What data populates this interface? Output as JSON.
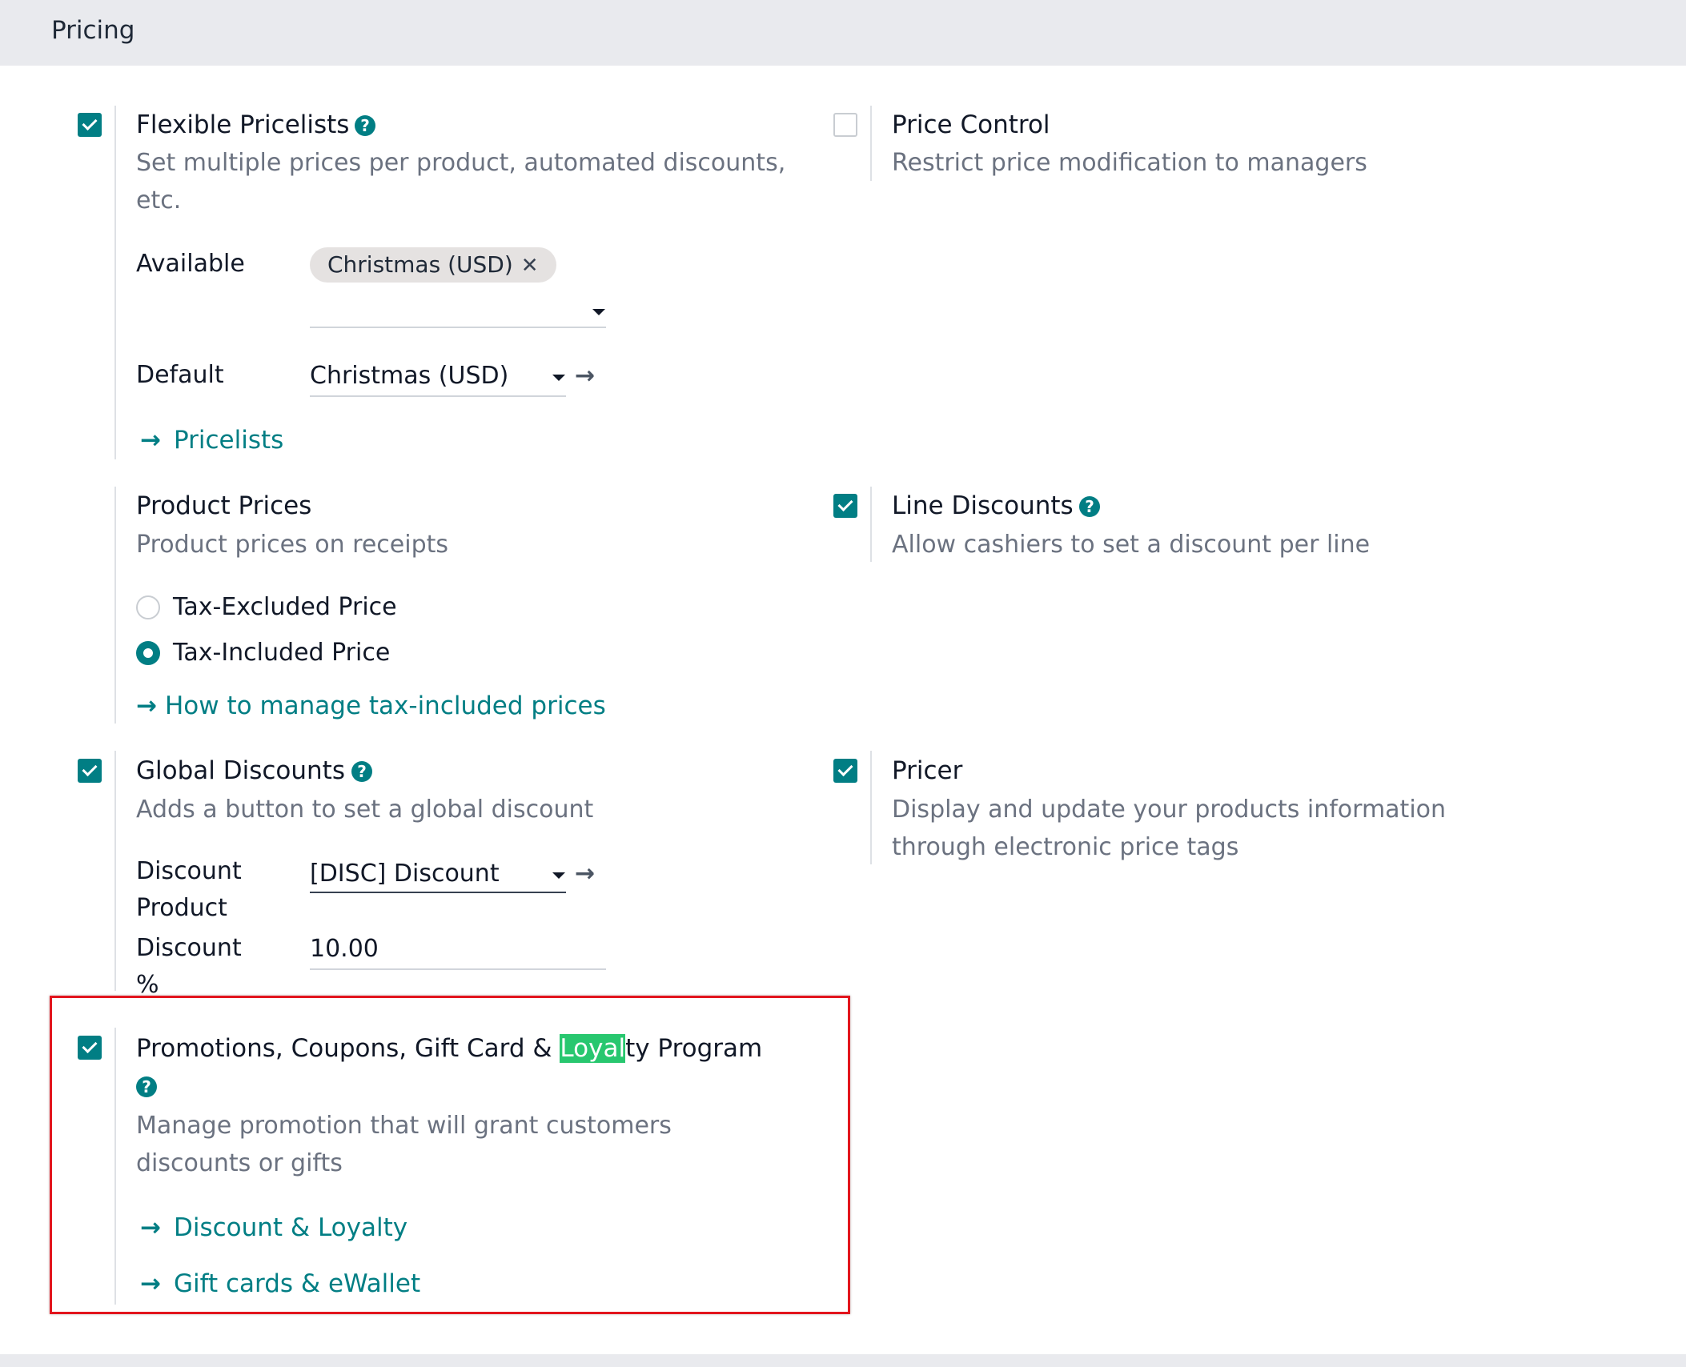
{
  "header": {
    "title": "Pricing"
  },
  "flexible_pricelists": {
    "title": "Flexible Pricelists",
    "checked": true,
    "description": "Set multiple prices per product, automated discounts, etc.",
    "available_label": "Available",
    "available_tags": [
      "Christmas (USD)"
    ],
    "default_label": "Default",
    "default_value": "Christmas (USD)",
    "link": "Pricelists"
  },
  "price_control": {
    "title": "Price Control",
    "checked": false,
    "description": "Restrict price modification to managers"
  },
  "product_prices": {
    "title": "Product Prices",
    "description": "Product prices on receipts",
    "options": [
      {
        "label": "Tax-Excluded Price",
        "selected": false
      },
      {
        "label": "Tax-Included Price",
        "selected": true
      }
    ],
    "link": "How to manage tax-included prices"
  },
  "line_discounts": {
    "title": "Line Discounts",
    "checked": true,
    "description": "Allow cashiers to set a discount per line"
  },
  "global_discounts": {
    "title": "Global Discounts",
    "checked": true,
    "description": "Adds a button to set a global discount",
    "discount_product_label": "Discount Product",
    "discount_product_value": "[DISC] Discount",
    "discount_pct_label": "Discount %",
    "discount_pct_value": "10.00"
  },
  "pricer": {
    "title": "Pricer",
    "checked": true,
    "description": "Display and update your products information through electronic price tags"
  },
  "promotions": {
    "title_before": "Promotions, Coupons, Gift Card & ",
    "title_highlight": "Loyal",
    "title_after": "ty Program",
    "checked": true,
    "description": "Manage promotion that will grant customers discounts or gifts",
    "links": [
      "Discount & Loyalty",
      "Gift cards & eWallet"
    ]
  },
  "icons": {
    "arrow": "→",
    "help": "?",
    "remove_tag": "✕"
  },
  "colors": {
    "accent": "#017e84",
    "highlight": "#28c76f",
    "annotation_box": "#e2151d"
  }
}
